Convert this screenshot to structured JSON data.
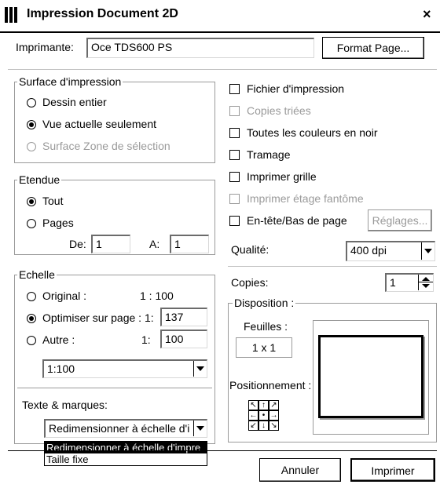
{
  "window": {
    "title": "Impression Document 2D",
    "close": "×"
  },
  "printer": {
    "label": "Imprimante:",
    "value": "Oce TDS600 PS",
    "format_button": "Format Page..."
  },
  "surface": {
    "legend": "Surface d'impression",
    "options": [
      "Dessin entier",
      "Vue actuelle seulement",
      "Surface Zone de sélection"
    ],
    "selected_index": 1
  },
  "etendue": {
    "legend": "Etendue",
    "options": [
      "Tout",
      "Pages"
    ],
    "selected_index": 0,
    "de_label": "De:",
    "de_value": "1",
    "a_label": "A:",
    "a_value": "1"
  },
  "echelle": {
    "legend": "Echelle",
    "original_label": "Original :",
    "original_value": "1 : 100",
    "optimiser_label": "Optimiser sur page :",
    "optimiser_prefix": "1:",
    "optimiser_value": "137",
    "autre_label": "Autre :",
    "autre_prefix": "1:",
    "autre_value": "100",
    "selected_index": 1,
    "scale_select": "1:100"
  },
  "texte": {
    "label": "Texte & marques:",
    "select_value": "Redimensionner à échelle d'i",
    "dropdown_options": [
      "Redimensionner à échelle d'impre",
      "Taille fixe"
    ]
  },
  "checks": [
    {
      "label": "Fichier d'impression",
      "disabled": false
    },
    {
      "label": "Copies triées",
      "disabled": true
    },
    {
      "label": "Toutes les couleurs en noir",
      "disabled": false
    },
    {
      "label": "Tramage",
      "disabled": false
    },
    {
      "label": "Imprimer grille",
      "disabled": false
    },
    {
      "label": "Imprimer étage fantôme",
      "disabled": true
    },
    {
      "label": "En-tête/Bas de page",
      "disabled": false
    }
  ],
  "reglages_button": "Réglages...",
  "qualite": {
    "label": "Qualité:",
    "value": "400 dpi"
  },
  "copies": {
    "label": "Copies:",
    "value": "1"
  },
  "disposition": {
    "legend": "Disposition :",
    "feuilles_label": "Feuilles :",
    "feuilles_value": "1 x 1",
    "positionnement_label": "Positionnement :"
  },
  "footer": {
    "cancel": "Annuler",
    "print": "Imprimer"
  }
}
